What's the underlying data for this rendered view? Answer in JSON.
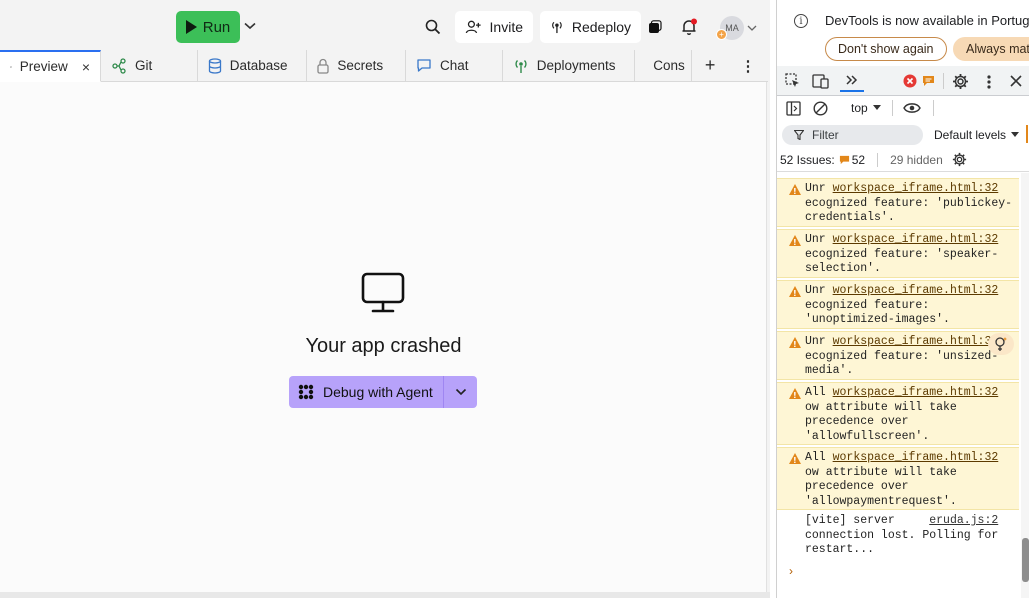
{
  "topbar": {
    "run_label": "Run",
    "invite_label": "Invite",
    "redeploy_label": "Redeploy",
    "avatar_initials": "MA",
    "avatar_badge": "+"
  },
  "tabs": [
    {
      "label": "Preview",
      "icon": "monitor-icon",
      "active": true,
      "close": "×"
    },
    {
      "label": "Git",
      "icon": "git-branch-icon"
    },
    {
      "label": "Database",
      "icon": "database-icon"
    },
    {
      "label": "Secrets",
      "icon": "lock-icon"
    },
    {
      "label": "Chat",
      "icon": "chat-bubble-icon"
    },
    {
      "label": "Deployments",
      "icon": "deployments-icon"
    },
    {
      "label": "Cons",
      "icon": "terminal-icon"
    }
  ],
  "tab_add": "+",
  "tab_more": "⋮",
  "preview": {
    "crash_title": "Your app crashed",
    "debug_label": "Debug with Agent"
  },
  "devtools": {
    "banner_text": "DevTools is now available in Portugu",
    "dont_show_label": "Don't show again",
    "always_label": "Always matc",
    "context": "top",
    "filter_label": "Filter",
    "levels_label": "Default levels",
    "issues_label": "52 Issues:",
    "issues_count": "52",
    "hidden_label": "29 hidden",
    "messages": [
      {
        "type": "warn",
        "prefix": "Unr",
        "source": "workspace_iframe.html:32",
        "text": "ecognized feature: 'publickey-credentials'."
      },
      {
        "type": "warn",
        "prefix": "Unr",
        "source": "workspace_iframe.html:32",
        "text": "ecognized feature: 'speaker-selection'."
      },
      {
        "type": "warn",
        "prefix": "Unr",
        "source": "workspace_iframe.html:32",
        "text": "ecognized feature: 'unoptimized-images'."
      },
      {
        "type": "warn",
        "prefix": "Unr",
        "source": "workspace_iframe.html:32",
        "text": "ecognized feature: 'unsized-media'."
      },
      {
        "type": "warn",
        "prefix": "All",
        "source": "workspace_iframe.html:32",
        "text": "ow attribute will take precedence over 'allowfullscreen'."
      },
      {
        "type": "warn",
        "prefix": "All",
        "source": "workspace_iframe.html:32",
        "text": "ow attribute will take precedence over 'allowpaymentrequest'."
      },
      {
        "type": "log",
        "prefix": "[vite] server",
        "source": "eruda.js:2",
        "text": "connection lost. Polling for restart..."
      }
    ],
    "prompt": "›"
  },
  "colors": {
    "run_green": "#3cbf58",
    "debug_purple": "#b7a2fa",
    "warn_bg": "#fef6d5",
    "warn_icon": "#e2871a",
    "error_red": "#e53935"
  }
}
